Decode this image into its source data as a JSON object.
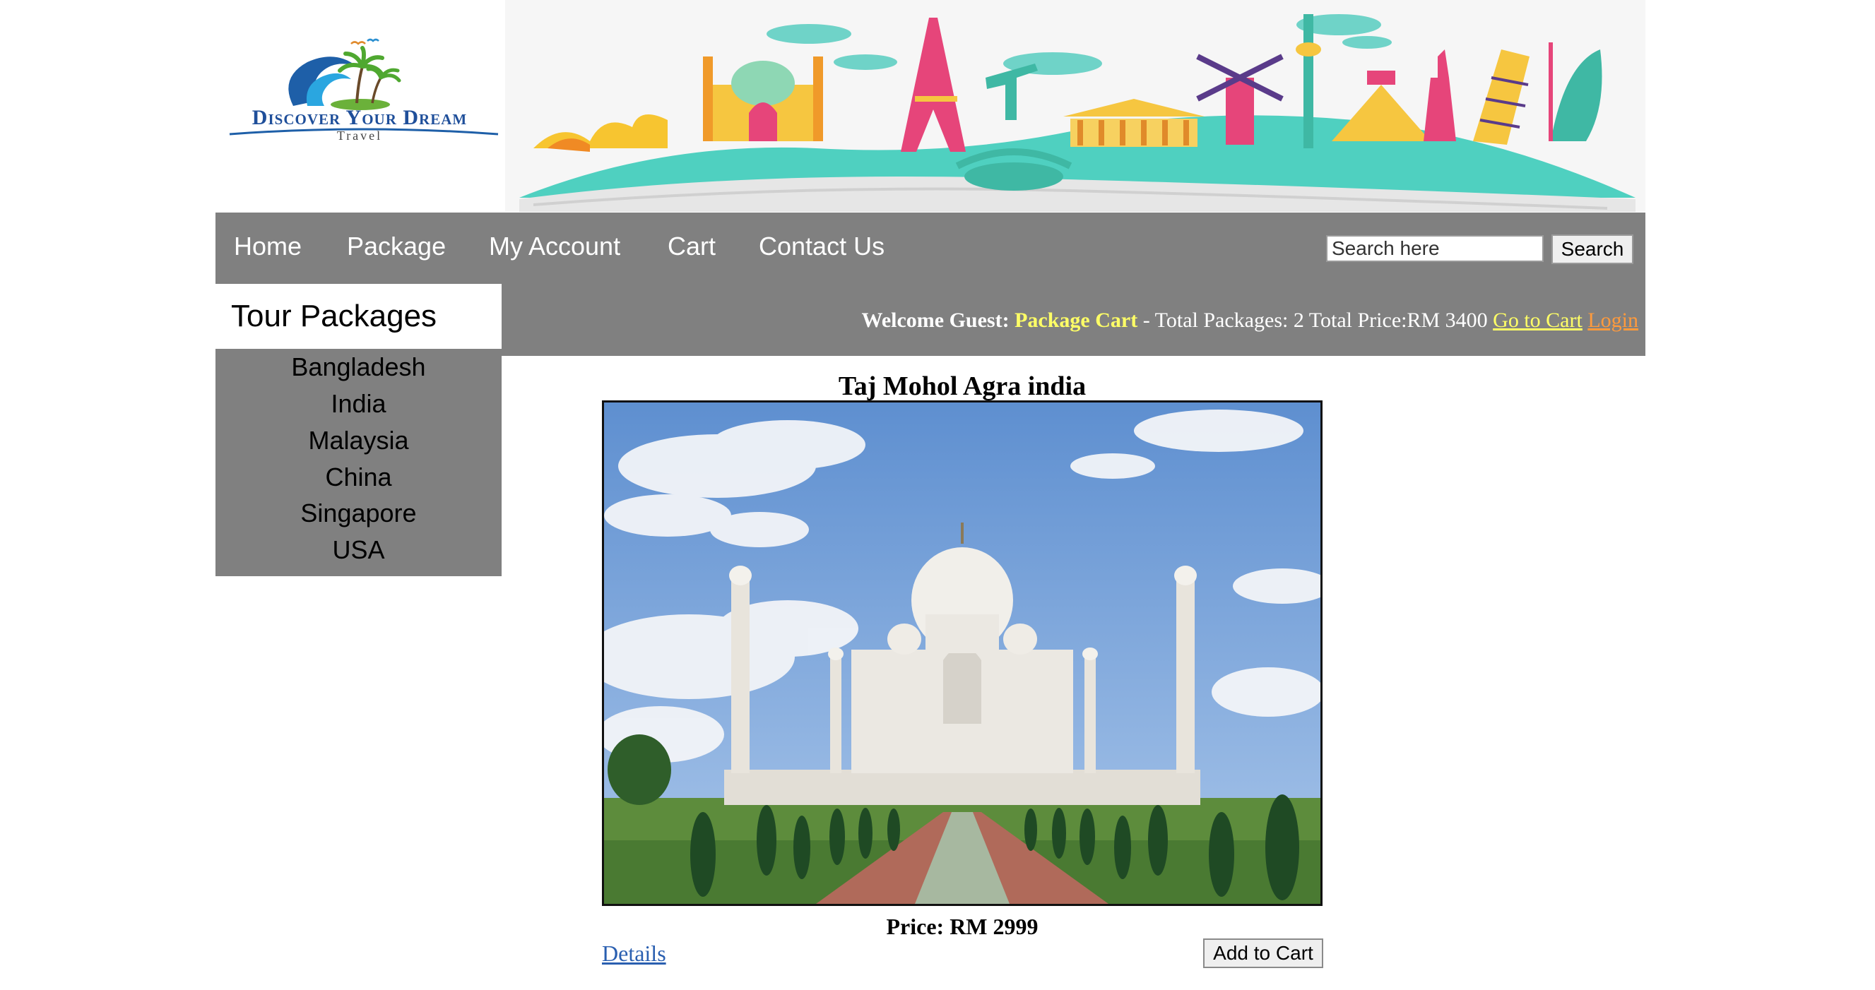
{
  "brand": {
    "name": "Discover Your Dream",
    "sub": "Travel"
  },
  "nav": {
    "items": [
      {
        "label": "Home"
      },
      {
        "label": "Package"
      },
      {
        "label": "My Account"
      },
      {
        "label": "Cart"
      },
      {
        "label": "Contact Us"
      }
    ],
    "search_placeholder": "Search here",
    "search_button": "Search"
  },
  "status": {
    "welcome": "Welcome Guest:",
    "cart_label": "Package Cart",
    "summary": " - Total Packages: 2 Total Price:RM 3400 ",
    "go_to_cart": "Go to Cart",
    "login": "Login"
  },
  "sidebar": {
    "title": "Tour Packages",
    "items": [
      {
        "label": "Bangladesh"
      },
      {
        "label": "India"
      },
      {
        "label": "Malaysia"
      },
      {
        "label": "China"
      },
      {
        "label": "Singapore"
      },
      {
        "label": "USA"
      }
    ]
  },
  "package": {
    "title": "Taj Mohol Agra india",
    "price": "Price: RM 2999",
    "details_link": "Details",
    "add_to_cart": "Add to Cart"
  },
  "colors": {
    "nav_bg": "#808080",
    "highlight_yellow": "#ffff66",
    "login_orange": "#ff9a3c",
    "details_blue": "#2a5fb0"
  }
}
